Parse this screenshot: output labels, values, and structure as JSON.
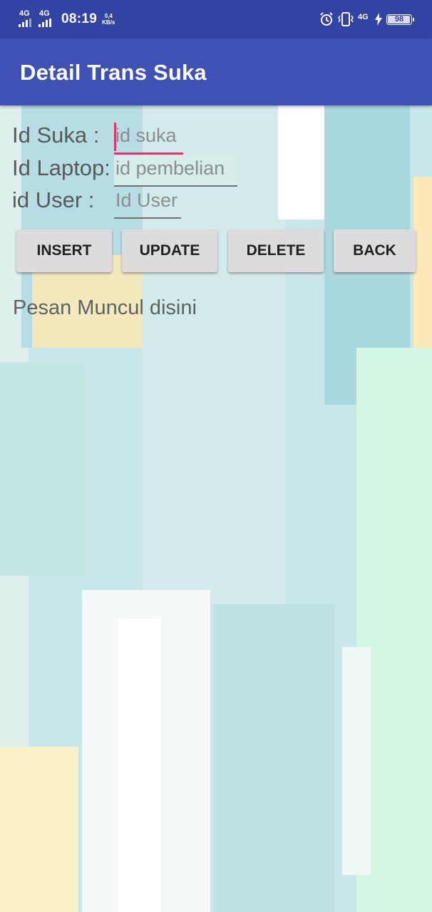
{
  "status_bar": {
    "network_1": "4G",
    "network_2": "4G",
    "time": "08:19",
    "speed_value": "0,4",
    "speed_unit": "KB/s",
    "network_right": "4G",
    "battery_level": "98"
  },
  "app_bar": {
    "title": "Detail Trans Suka"
  },
  "form": {
    "id_suka": {
      "label": "Id Suka :",
      "placeholder": "id suka",
      "value": ""
    },
    "id_laptop": {
      "label": "Id Laptop:",
      "placeholder": "id pembelian",
      "value": ""
    },
    "id_user": {
      "label": "id User :",
      "placeholder": "Id User",
      "value": ""
    }
  },
  "buttons": {
    "insert": "INSERT",
    "update": "UPDATE",
    "delete": "DELETE",
    "back": "BACK"
  },
  "message": "Pesan Muncul disini",
  "colors": {
    "status_bar": "#3243a4",
    "app_bar": "#3f51b5",
    "accent": "#e0336b"
  }
}
